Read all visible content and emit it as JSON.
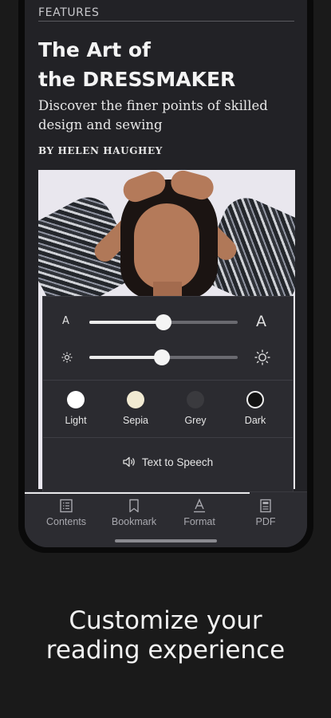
{
  "article": {
    "kicker": "FEATURES",
    "title_line1": "The Art of",
    "title_line2": "the DRESSMAKER",
    "standfirst": "Discover the finer points of skilled design and sewing",
    "byline": "BY HELEN HAUGHEY"
  },
  "format_panel": {
    "font_size_small_glyph": "A",
    "font_size_large_glyph": "A",
    "font_size_level": 0.5,
    "brightness_level": 0.49,
    "themes": [
      {
        "label": "Light",
        "color": "#ffffff"
      },
      {
        "label": "Sepia",
        "color": "#f1ead2"
      },
      {
        "label": "Grey",
        "color": "#3a3a3e"
      },
      {
        "label": "Dark",
        "color": "#111111"
      }
    ],
    "tts_label": "Text to Speech"
  },
  "tabs": [
    {
      "label": "Contents",
      "icon": "contents-icon"
    },
    {
      "label": "Bookmark",
      "icon": "bookmark-icon"
    },
    {
      "label": "Format",
      "icon": "format-icon"
    },
    {
      "label": "PDF",
      "icon": "pdf-icon"
    }
  ],
  "caption": {
    "line1": "Customize your",
    "line2": "reading experience"
  }
}
